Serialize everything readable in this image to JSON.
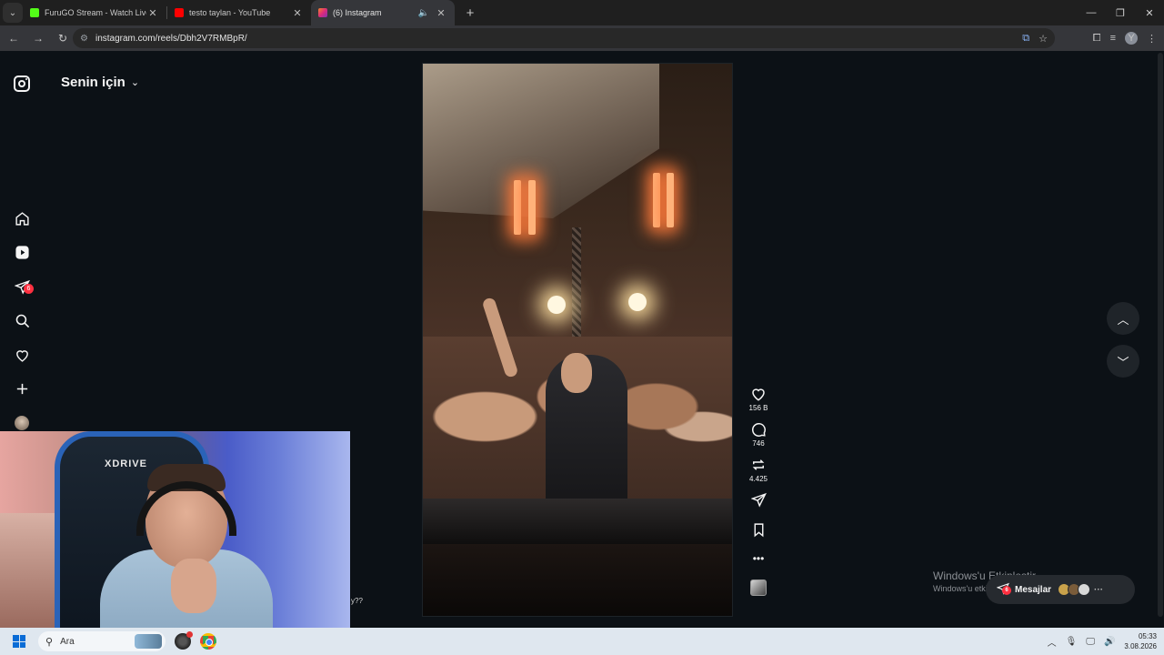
{
  "browser": {
    "tabs": [
      {
        "title": "FuruGO Stream - Watch Live on",
        "favicon_color": "#53fc18",
        "active": false
      },
      {
        "title": "testo taylan - YouTube",
        "favicon_color": "#ff0000",
        "active": false
      },
      {
        "title": "(6) Instagram",
        "favicon_color": "#e1306c",
        "active": true
      }
    ],
    "url": "instagram.com/reels/Dbh2V7RMBpR/",
    "profile_initial": "Y"
  },
  "instagram": {
    "feed_title": "Senin için",
    "notification_count": "6",
    "reel_actions": {
      "likes": "156 B",
      "comments": "746",
      "reposts": "4.425"
    },
    "messages_label": "Mesajlar",
    "messages_badge": "6"
  },
  "overlay": {
    "webcam_brand": "XDRIVE",
    "cut_text": "y??"
  },
  "watermark": {
    "line1": "Windows'u Etkinleştir",
    "line2": "Windows'u etkinleştirmek için Ayarlar'a gidin."
  },
  "taskbar": {
    "search_placeholder": "Ara",
    "time": "05:33",
    "date": "3.08.2026"
  },
  "colors": {
    "ig_background": "#0c1116",
    "notification_red": "#ff3040"
  }
}
